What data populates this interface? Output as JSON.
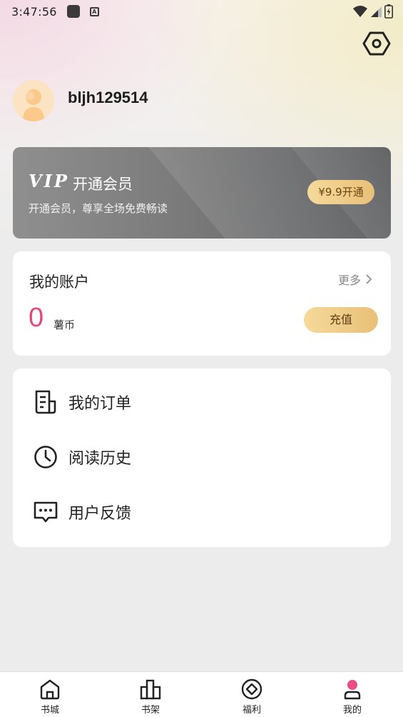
{
  "status_bar": {
    "time": "3:47:56",
    "notification_icons": [
      "app-square-icon",
      "a-badge-icon"
    ],
    "app_badge_letter": "A",
    "system_icons": [
      "wifi-icon",
      "signal-icon",
      "battery-icon"
    ]
  },
  "header": {
    "settings_icon": "hexagon-settings-icon"
  },
  "profile": {
    "username": "bljh129514",
    "avatar_icon": "default-avatar-icon"
  },
  "vip": {
    "logo": "VIP",
    "title": "开通会员",
    "subtitle": "开通会员，尊享全场免费畅读",
    "button_label": "¥9.9开通"
  },
  "account": {
    "title": "我的账户",
    "more_label": "更多",
    "balance": "0",
    "unit": "薯币",
    "recharge_label": "充值"
  },
  "menu": {
    "items": [
      {
        "label": "我的订单",
        "icon": "order-document-icon"
      },
      {
        "label": "阅读历史",
        "icon": "clock-icon"
      },
      {
        "label": "用户反馈",
        "icon": "chat-bubble-icon"
      }
    ]
  },
  "bottom_nav": {
    "items": [
      {
        "label": "书城",
        "icon": "home-icon"
      },
      {
        "label": "书架",
        "icon": "bookshelf-icon"
      },
      {
        "label": "福利",
        "icon": "diamond-circle-icon"
      },
      {
        "label": "我的",
        "icon": "user-icon",
        "active": true
      }
    ]
  },
  "colors": {
    "accent_pink": "#e04a7c",
    "gold_button": "#e9c079",
    "vip_card": "#7a7a7a",
    "background": "#ececec"
  }
}
